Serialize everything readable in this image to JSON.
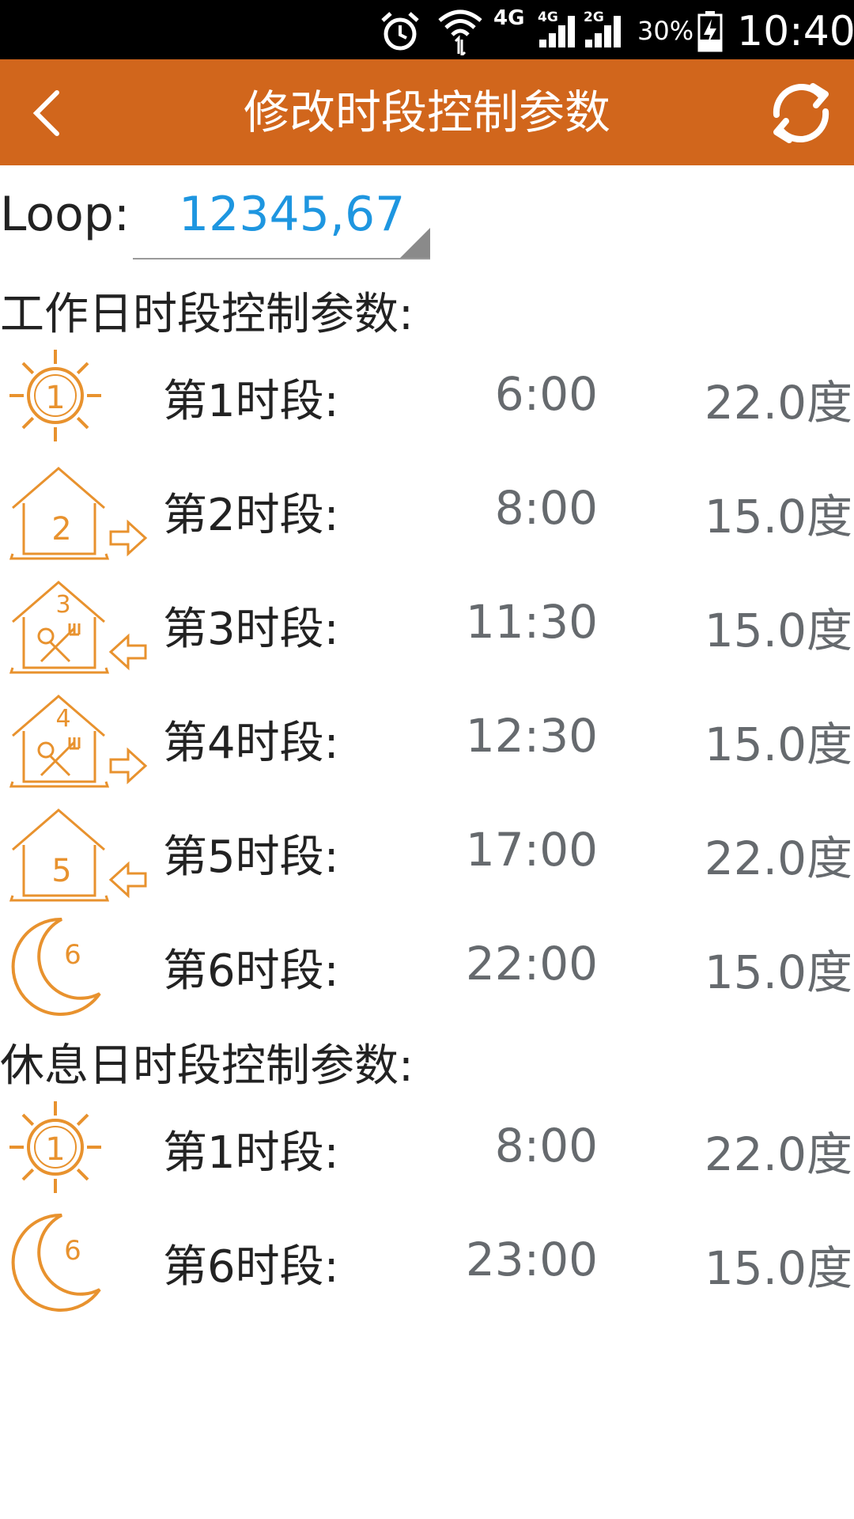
{
  "status_bar": {
    "network_4g": "4G",
    "sig1_label": "4G",
    "sig2_label": "2G",
    "battery": "30%",
    "time": "10:40"
  },
  "header": {
    "title": "修改时段控制参数",
    "back_icon": "chevron-left-icon",
    "refresh_icon": "refresh-icon"
  },
  "loop": {
    "label": "Loop:",
    "value": "12345,67"
  },
  "workday": {
    "title": "工作日时段控制参数:",
    "rows": [
      {
        "icon": "sun-icon",
        "num": "1",
        "label": "第1时段:",
        "time": "6:00",
        "temp": "22.0度"
      },
      {
        "icon": "house-out-icon",
        "num": "2",
        "label": "第2时段:",
        "time": "8:00",
        "temp": "15.0度"
      },
      {
        "icon": "house-dining-in-icon",
        "num": "3",
        "label": "第3时段:",
        "time": "11:30",
        "temp": "15.0度"
      },
      {
        "icon": "house-dining-out-icon",
        "num": "4",
        "label": "第4时段:",
        "time": "12:30",
        "temp": "15.0度"
      },
      {
        "icon": "house-in-icon",
        "num": "5",
        "label": "第5时段:",
        "time": "17:00",
        "temp": "22.0度"
      },
      {
        "icon": "moon-icon",
        "num": "6",
        "label": "第6时段:",
        "time": "22:00",
        "temp": "15.0度"
      }
    ]
  },
  "restday": {
    "title": "休息日时段控制参数:",
    "rows": [
      {
        "icon": "sun-icon",
        "num": "1",
        "label": "第1时段:",
        "time": "8:00",
        "temp": "22.0度"
      },
      {
        "icon": "moon-icon",
        "num": "6",
        "label": "第6时段:",
        "time": "23:00",
        "temp": "15.0度"
      }
    ]
  },
  "colors": {
    "accent": "#d1661c",
    "icon_orange": "#e8922e",
    "loop_value": "#1e96e0"
  }
}
